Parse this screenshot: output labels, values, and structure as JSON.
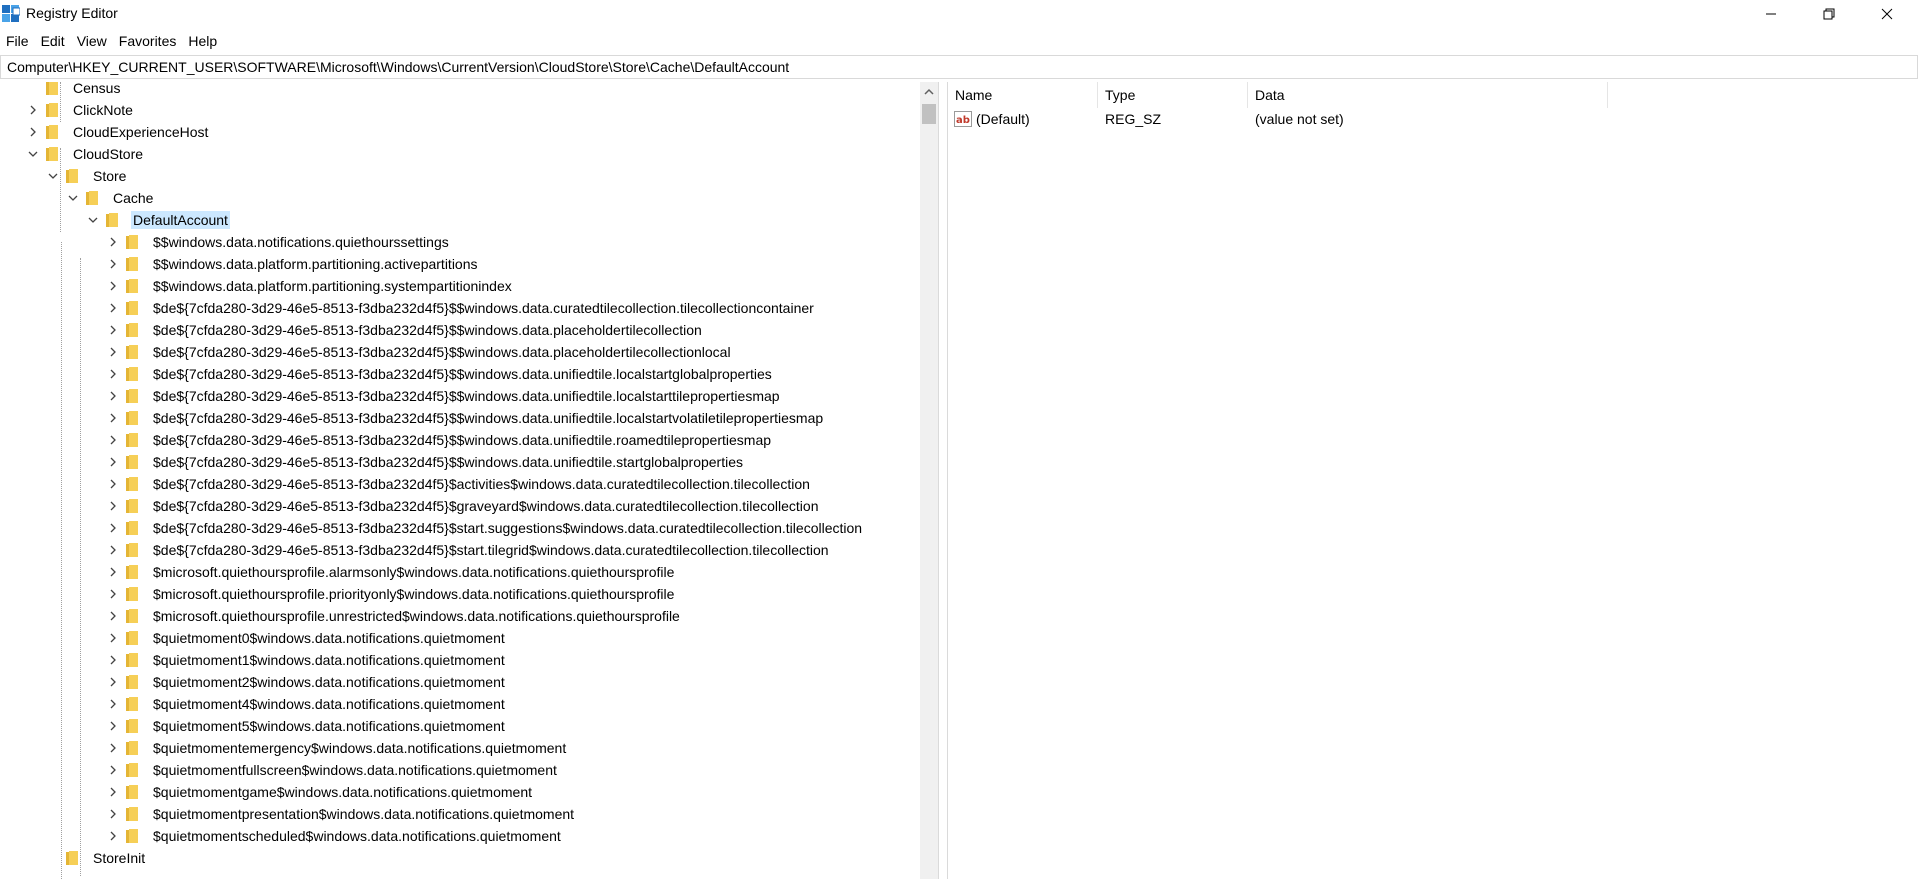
{
  "window": {
    "title": "Registry Editor",
    "menu": [
      "File",
      "Edit",
      "View",
      "Favorites",
      "Help"
    ]
  },
  "address": "Computer\\HKEY_CURRENT_USER\\SOFTWARE\\Microsoft\\Windows\\CurrentVersion\\CloudStore\\Store\\Cache\\DefaultAccount",
  "tree": [
    {
      "label": "Census",
      "level": 0,
      "state": "none"
    },
    {
      "label": "ClickNote",
      "level": 0,
      "state": "collapsed"
    },
    {
      "label": "CloudExperienceHost",
      "level": 0,
      "state": "collapsed"
    },
    {
      "label": "CloudStore",
      "level": 0,
      "state": "expanded"
    },
    {
      "label": "Store",
      "level": 1,
      "state": "expanded"
    },
    {
      "label": "Cache",
      "level": 2,
      "state": "expanded"
    },
    {
      "label": "DefaultAccount",
      "level": 3,
      "state": "expanded",
      "selected": true
    },
    {
      "label": "$$windows.data.notifications.quiethourssettings",
      "level": 4,
      "state": "collapsed"
    },
    {
      "label": "$$windows.data.platform.partitioning.activepartitions",
      "level": 4,
      "state": "collapsed"
    },
    {
      "label": "$$windows.data.platform.partitioning.systempartitionindex",
      "level": 4,
      "state": "collapsed"
    },
    {
      "label": "$de${7cfda280-3d29-46e5-8513-f3dba232d4f5}$$windows.data.curatedtilecollection.tilecollectioncontainer",
      "level": 4,
      "state": "collapsed"
    },
    {
      "label": "$de${7cfda280-3d29-46e5-8513-f3dba232d4f5}$$windows.data.placeholdertilecollection",
      "level": 4,
      "state": "collapsed"
    },
    {
      "label": "$de${7cfda280-3d29-46e5-8513-f3dba232d4f5}$$windows.data.placeholdertilecollectionlocal",
      "level": 4,
      "state": "collapsed"
    },
    {
      "label": "$de${7cfda280-3d29-46e5-8513-f3dba232d4f5}$$windows.data.unifiedtile.localstartglobalproperties",
      "level": 4,
      "state": "collapsed"
    },
    {
      "label": "$de${7cfda280-3d29-46e5-8513-f3dba232d4f5}$$windows.data.unifiedtile.localstarttilepropertiesmap",
      "level": 4,
      "state": "collapsed"
    },
    {
      "label": "$de${7cfda280-3d29-46e5-8513-f3dba232d4f5}$$windows.data.unifiedtile.localstartvolatiletilepropertiesmap",
      "level": 4,
      "state": "collapsed"
    },
    {
      "label": "$de${7cfda280-3d29-46e5-8513-f3dba232d4f5}$$windows.data.unifiedtile.roamedtilepropertiesmap",
      "level": 4,
      "state": "collapsed"
    },
    {
      "label": "$de${7cfda280-3d29-46e5-8513-f3dba232d4f5}$$windows.data.unifiedtile.startglobalproperties",
      "level": 4,
      "state": "collapsed"
    },
    {
      "label": "$de${7cfda280-3d29-46e5-8513-f3dba232d4f5}$activities$windows.data.curatedtilecollection.tilecollection",
      "level": 4,
      "state": "collapsed"
    },
    {
      "label": "$de${7cfda280-3d29-46e5-8513-f3dba232d4f5}$graveyard$windows.data.curatedtilecollection.tilecollection",
      "level": 4,
      "state": "collapsed"
    },
    {
      "label": "$de${7cfda280-3d29-46e5-8513-f3dba232d4f5}$start.suggestions$windows.data.curatedtilecollection.tilecollection",
      "level": 4,
      "state": "collapsed"
    },
    {
      "label": "$de${7cfda280-3d29-46e5-8513-f3dba232d4f5}$start.tilegrid$windows.data.curatedtilecollection.tilecollection",
      "level": 4,
      "state": "collapsed"
    },
    {
      "label": "$microsoft.quiethoursprofile.alarmsonly$windows.data.notifications.quiethoursprofile",
      "level": 4,
      "state": "collapsed"
    },
    {
      "label": "$microsoft.quiethoursprofile.priorityonly$windows.data.notifications.quiethoursprofile",
      "level": 4,
      "state": "collapsed"
    },
    {
      "label": "$microsoft.quiethoursprofile.unrestricted$windows.data.notifications.quiethoursprofile",
      "level": 4,
      "state": "collapsed"
    },
    {
      "label": "$quietmoment0$windows.data.notifications.quietmoment",
      "level": 4,
      "state": "collapsed"
    },
    {
      "label": "$quietmoment1$windows.data.notifications.quietmoment",
      "level": 4,
      "state": "collapsed"
    },
    {
      "label": "$quietmoment2$windows.data.notifications.quietmoment",
      "level": 4,
      "state": "collapsed"
    },
    {
      "label": "$quietmoment4$windows.data.notifications.quietmoment",
      "level": 4,
      "state": "collapsed"
    },
    {
      "label": "$quietmoment5$windows.data.notifications.quietmoment",
      "level": 4,
      "state": "collapsed"
    },
    {
      "label": "$quietmomentemergency$windows.data.notifications.quietmoment",
      "level": 4,
      "state": "collapsed"
    },
    {
      "label": "$quietmomentfullscreen$windows.data.notifications.quietmoment",
      "level": 4,
      "state": "collapsed"
    },
    {
      "label": "$quietmomentgame$windows.data.notifications.quietmoment",
      "level": 4,
      "state": "collapsed"
    },
    {
      "label": "$quietmomentpresentation$windows.data.notifications.quietmoment",
      "level": 4,
      "state": "collapsed"
    },
    {
      "label": "$quietmomentscheduled$windows.data.notifications.quietmoment",
      "level": 4,
      "state": "collapsed"
    },
    {
      "label": "StoreInit",
      "level": 1,
      "state": "none"
    }
  ],
  "values": {
    "columns": [
      "Name",
      "Type",
      "Data"
    ],
    "rows": [
      {
        "name": "(Default)",
        "type": "REG_SZ",
        "data": "(value not set)",
        "icon": "string-value-icon"
      }
    ]
  },
  "colors": {
    "selection": "#cce8ff",
    "folder": "#f6cf57",
    "folder_dark": "#e4b535"
  }
}
